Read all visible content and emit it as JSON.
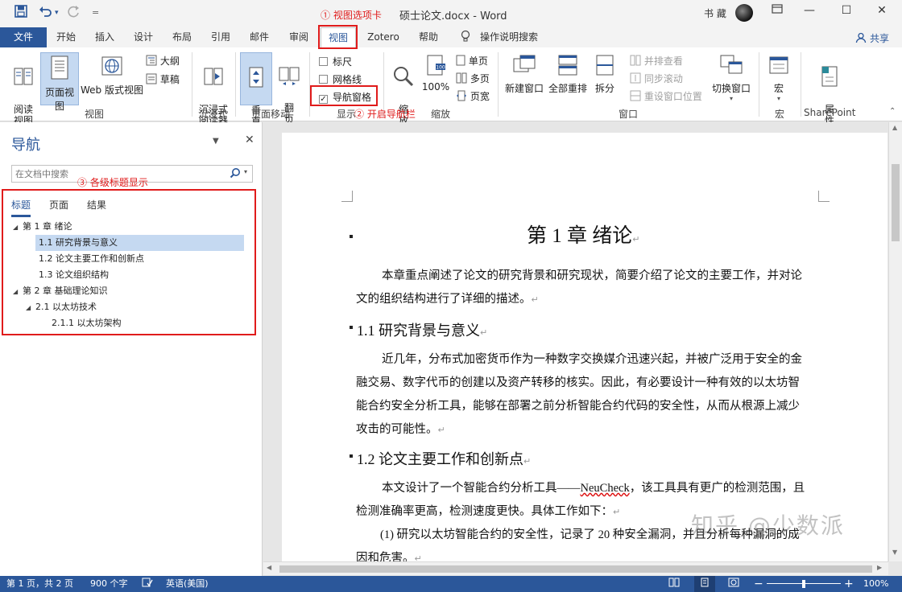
{
  "window": {
    "doc_title": "硕士论文.docx  -  Word",
    "user_name": "书 藏",
    "minimize": "—",
    "restore": "⧉",
    "maximize": "☐",
    "close": "✕"
  },
  "quick_access": {
    "save_icon": "save-icon",
    "undo_icon": "undo-icon",
    "redo_icon": "redo-icon",
    "more": "="
  },
  "tabs": [
    "文件",
    "开始",
    "插入",
    "设计",
    "布局",
    "引用",
    "邮件",
    "审阅",
    "视图",
    "Zotero",
    "帮助",
    "操作说明搜索"
  ],
  "share_label": "共享",
  "ribbon": {
    "views": {
      "read_mode": "阅读\n视图",
      "print_layout": "页面视图",
      "web_layout": "Web 版式视图",
      "outline": "大纲",
      "draft": "草稿",
      "group": "视图"
    },
    "immersive": {
      "reader": "沉浸式\n阅读器",
      "group": "沉浸式"
    },
    "page_move": {
      "vertical": "垂\n直",
      "side": "翻\n页",
      "group": "页面移动"
    },
    "show": {
      "ruler": "标尺",
      "gridlines": "网格线",
      "nav_pane": "导航窗格",
      "nav_pane_checked": true,
      "group": "显示"
    },
    "zoom": {
      "zoom": "缩\n放",
      "pct": "100%",
      "one_page": "单页",
      "multi_page": "多页",
      "page_width": "页宽",
      "group": "缩放"
    },
    "window": {
      "new_window": "新建窗口",
      "arrange_all": "全部重排",
      "split": "拆分",
      "side_by_side": "并排查看",
      "sync_scroll": "同步滚动",
      "reset_pos": "重设窗口位置",
      "switch": "切换窗口",
      "group": "窗口"
    },
    "macros": {
      "label": "宏",
      "group": "宏"
    },
    "sharepoint": {
      "label": "属\n性",
      "group": "SharePoint"
    }
  },
  "annotations": {
    "a1": "① 视图选项卡",
    "a2": "② 开启导航栏",
    "a3": "③ 各级标题显示"
  },
  "nav": {
    "title": "导航",
    "search_placeholder": "在文档中搜索",
    "tabs": [
      "标题",
      "页面",
      "结果"
    ],
    "headings": [
      {
        "label": "第 1 章  绪论",
        "level": 1,
        "expanded": true
      },
      {
        "label": "1.1  研究背景与意义",
        "level": 2,
        "selected": true
      },
      {
        "label": "1.2  论文主要工作和创新点",
        "level": 2
      },
      {
        "label": "1.3  论文组织结构",
        "level": 2
      },
      {
        "label": "第 2 章  基础理论知识",
        "level": 1,
        "expanded": true
      },
      {
        "label": "2.1  以太坊技术",
        "level": 2,
        "expanded": true
      },
      {
        "label": "2.1.1  以太坊架构",
        "level": 3
      }
    ]
  },
  "document": {
    "chapter_title": "第 1 章  绪论",
    "intro_line1": "本章重点阐述了论文的研究背景和研究现状，简要介绍了论文的主要工作，并对论",
    "intro_line2": "文的组织结构进行了详细的描述。",
    "h_1_1": "1.1  研究背景与意义",
    "p1_line1": "近几年，分布式加密货币作为一种数字交换媒介迅速兴起，并被广泛用于安全的金",
    "p1_line2": "融交易、数字代币的创建以及资产转移的核实。因此，有必要设计一种有效的以太坊智",
    "p1_line3": "能合约安全分析工具，能够在部署之前分析智能合约代码的安全性，从而从根源上减少",
    "p1_line4": "攻击的可能性。",
    "h_1_2": "1.2  论文主要工作和创新点",
    "p2_line1_a": "本文设计了一个智能合约分析工具——",
    "p2_line1_b": "NeuCheck",
    "p2_line1_c": "，该工具具有更广的检测范围，且",
    "p2_line2": "检测准确率更高，检测速度更快。具体工作如下：",
    "p3_line1": "(1) 研究以太坊智能合约的安全性，记录了 20 种安全漏洞，并且分析每种漏洞的成",
    "p3_line2": "因和危害。",
    "para_mark": "↵"
  },
  "status": {
    "page": "第 1 页，共 2 页",
    "words": "900 个字",
    "lang": "英语(美国)",
    "zoom": "100%",
    "zoom_fraction": 0.5
  },
  "watermark": "知乎 @少数派",
  "colors": {
    "accent": "#2b579a",
    "annotation": "#e01b1b",
    "selected": "#c5d9f1"
  }
}
